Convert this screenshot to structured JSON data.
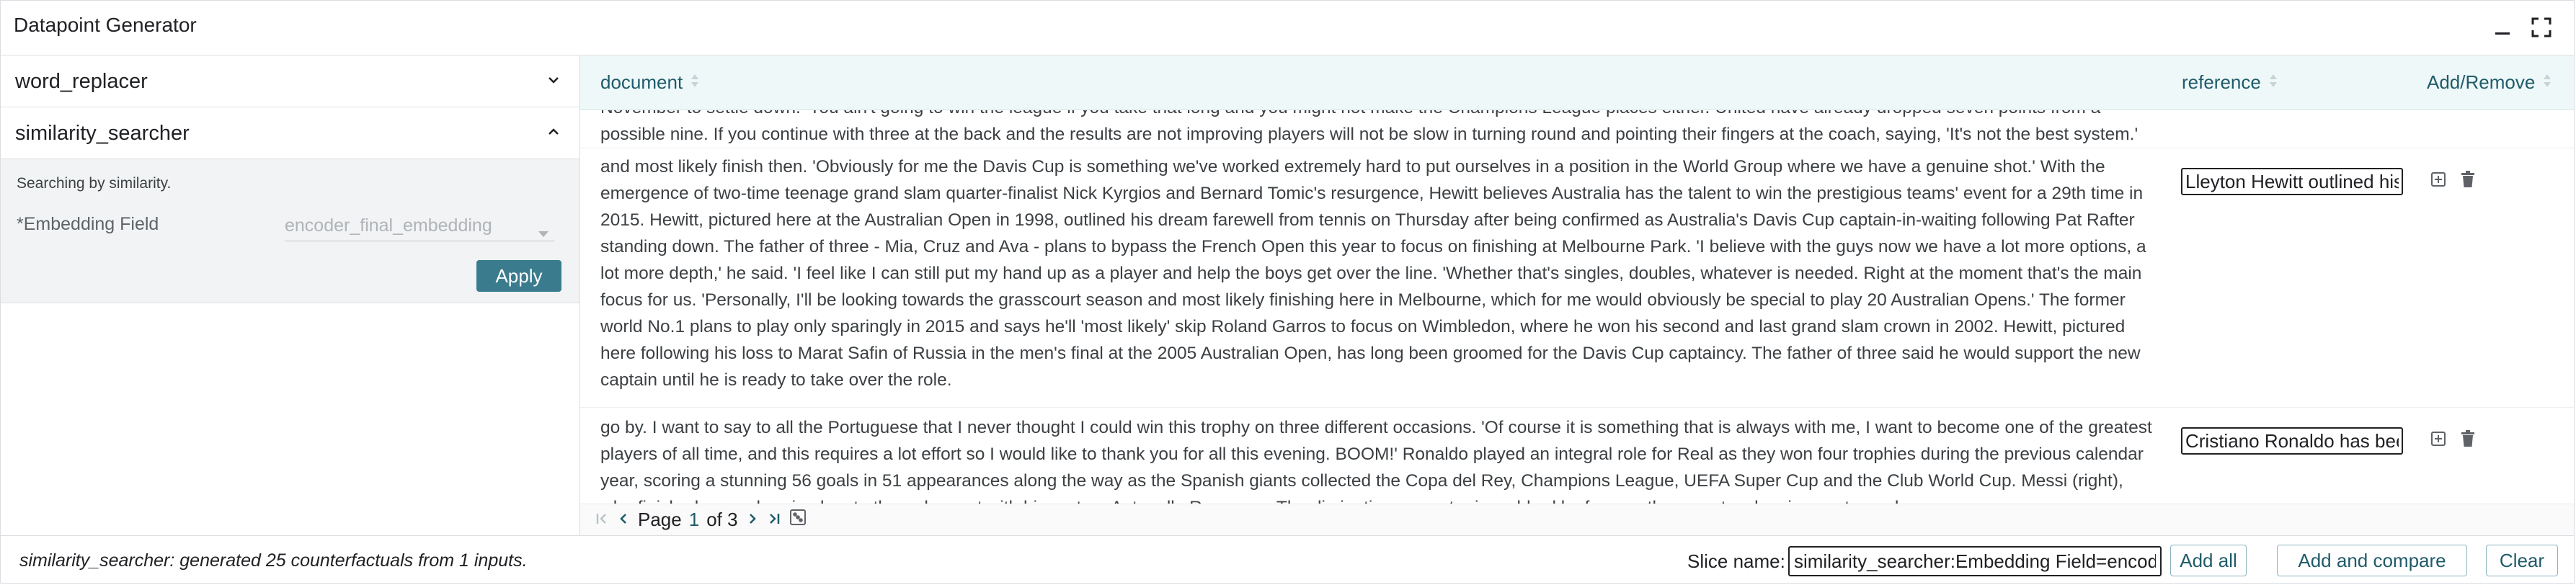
{
  "window": {
    "title": "Datapoint Generator",
    "minimize_icon": "minimize-icon",
    "fullscreen_icon": "fullscreen-icon"
  },
  "generators": [
    {
      "label": "word_replacer",
      "expanded": false
    },
    {
      "label": "similarity_searcher",
      "expanded": true
    }
  ],
  "similarity_searcher": {
    "description": "Searching by similarity.",
    "field_label": "*Embedding Field",
    "field_value": "encoder_final_embedding",
    "apply_label": "Apply"
  },
  "table": {
    "columns": [
      "document",
      "reference",
      "Add/Remove"
    ],
    "rows": [
      {
        "document_top": "November to settle down. 'You ain't going to win the league if you take that long and you might not make the Champions League places either. United have already dropped seven points from a possible nine. If you continue with three at the back and the results are not improving players will not be slow in turning round and pointing their fingers at the coach, saying, 'It's not the best system.' His record with the team will be put under the spotlight and we might think the team which Van Gaal reshaped successfully for Holland during the World Cup in Brazil"
      },
      {
        "document": "and most likely finish then. 'Obviously for me the Davis Cup is something we've worked extremely hard to put ourselves in a position in the World Group where we have a genuine shot.' With the emergence of two-time teenage grand slam quarter-finalist Nick Kyrgios and Bernard Tomic's resurgence, Hewitt believes Australia has the talent to win the prestigious teams' event for a 29th time in 2015. Hewitt, pictured here at the Australian Open in 1998, outlined his dream farewell from tennis on Thursday after being confirmed as Australia's Davis Cup captain-in-waiting following Pat Rafter standing down. The father of three - Mia, Cruz and Ava - plans to bypass the French Open this year to focus on finishing at Melbourne Park. 'I believe with the guys now we have a lot more options, a lot more depth,' he said. 'I feel like I can still put my hand up as a player and help the boys get over the line. 'Whether that's singles, doubles, whatever is needed. Right at the moment that's the main focus for us. 'Personally, I'll be looking towards the grasscourt season and most likely finishing here in Melbourne, which for me would obviously be special to play 20 Australian Opens.' The former world No.1 plans to play only sparingly in 2015 and says he'll 'most likely' skip Roland Garros to focus on Wimbledon, where he won his second and last grand slam crown in 2002. Hewitt, pictured here following his loss to Marat Safin of Russia in the men's final at the 2005 Australian Open, has long been groomed for the Davis Cup captaincy. The father of three said he would support the new captain until he is ready to take over the role.",
        "reference": "Lleyton Hewitt outlined his dream farewell"
      },
      {
        "document": "go by. I want to say to all the Portuguese that I never thought I could win this trophy on three different occasions. 'Of course it is something that is always with me, I want to become one of the greatest players of all time, and this requires a lot effort so I would like to thank you for all this evening. BOOM!' Ronaldo played an integral role for Real as they won four trophies during the previous calendar year, scoring a stunning 56 goals in 51 appearances along the way as the Spanish giants collected the Copa del Rey, Champions League, UEFA Super Cup and the Club World Cup. Messi (right), who finished second, arrived on to the red carpet with his partner Antonella Roccuzzo. The diminutive superstar is mobbed by fans on the carpet as he signs autographs.",
        "reference": "Cristiano Ronaldo has been named the winner"
      }
    ]
  },
  "pager": {
    "page_label": "Page",
    "current": "1",
    "of_label": "of 3"
  },
  "status": {
    "message": "similarity_searcher: generated 25 counterfactuals from 1 inputs.",
    "slice_label": "Slice name:",
    "slice_value": "similarity_searcher:Embedding Field=encoder_final_embedding",
    "add_all_label": "Add all",
    "add_compare_label": "Add and compare",
    "clear_label": "Clear"
  },
  "colors": {
    "accent": "#3a7c8e",
    "header_bg": "#eef8f8",
    "panel_bg": "#f1f3f4"
  }
}
